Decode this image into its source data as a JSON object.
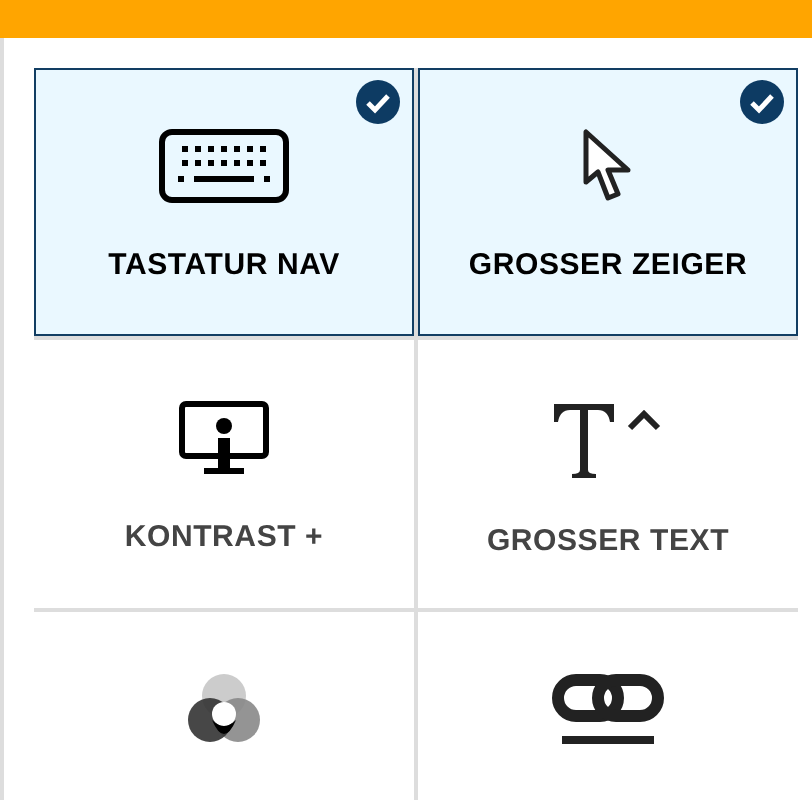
{
  "tiles": [
    {
      "kind": "keyboard",
      "label": "TASTATUR NAV",
      "selected": true
    },
    {
      "kind": "pointer",
      "label": "GROSSER ZEIGER",
      "selected": true
    },
    {
      "kind": "contrast",
      "label": "KONTRAST +",
      "selected": false
    },
    {
      "kind": "text",
      "label": "GROSSER TEXT",
      "selected": false
    },
    {
      "kind": "saturation",
      "selected": false
    },
    {
      "kind": "links",
      "selected": false
    }
  ]
}
